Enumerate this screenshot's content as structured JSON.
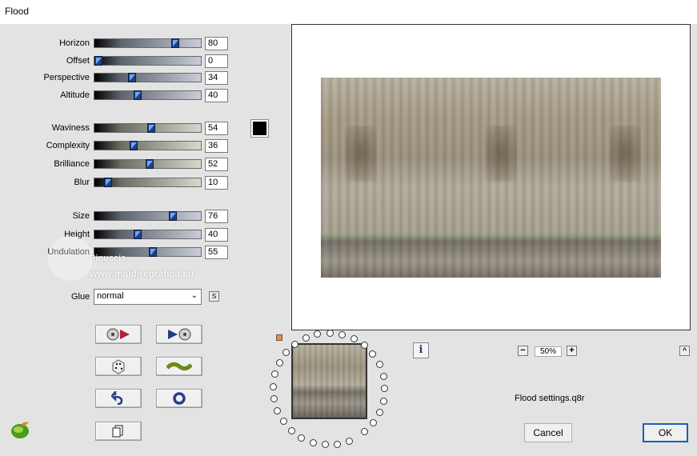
{
  "window": {
    "title": "Flood"
  },
  "sliders": [
    {
      "id": "horizon",
      "label": "Horizon",
      "value": "80",
      "fraction": 0.78
    },
    {
      "id": "offset",
      "label": "Offset",
      "value": "0",
      "fraction": 0.0
    },
    {
      "id": "perspective",
      "label": "Perspective",
      "value": "34",
      "fraction": 0.34
    },
    {
      "id": "altitude",
      "label": "Altitude",
      "value": "40",
      "fraction": 0.4
    },
    {
      "id": "waviness",
      "label": "Waviness",
      "value": "54",
      "fraction": 0.54
    },
    {
      "id": "complexity",
      "label": "Complexity",
      "value": "36",
      "fraction": 0.36
    },
    {
      "id": "brilliance",
      "label": "Brilliance",
      "value": "52",
      "fraction": 0.52
    },
    {
      "id": "blur",
      "label": "Blur",
      "value": "10",
      "fraction": 0.1
    },
    {
      "id": "size",
      "label": "Size",
      "value": "76",
      "fraction": 0.76
    },
    {
      "id": "height",
      "label": "Height",
      "value": "40",
      "fraction": 0.4
    },
    {
      "id": "undulation",
      "label": "Undulation",
      "value": "55",
      "fraction": 0.55
    }
  ],
  "color": {
    "swatch": "#000000"
  },
  "glue": {
    "label": "Glue",
    "value": "normal",
    "side_button": "S"
  },
  "tool_buttons": {
    "prev_preset_icon": "prev-preset-icon",
    "next_preset_icon": "next-preset-icon",
    "randomize_icon": "dice-icon",
    "wave_icon": "wave-icon",
    "undo_icon": "undo-icon",
    "reset_icon": "reset-ring-icon",
    "copy_icon": "copy-icon"
  },
  "preview": {
    "zoom": "50%",
    "info": "i",
    "up": "^"
  },
  "watermark": {
    "line1": "Pinuccia",
    "line2": "www.maidiregrafica.eu"
  },
  "status": {
    "filename": "Flood settings.q8r"
  },
  "buttons": {
    "cancel": "Cancel",
    "ok": "OK"
  }
}
